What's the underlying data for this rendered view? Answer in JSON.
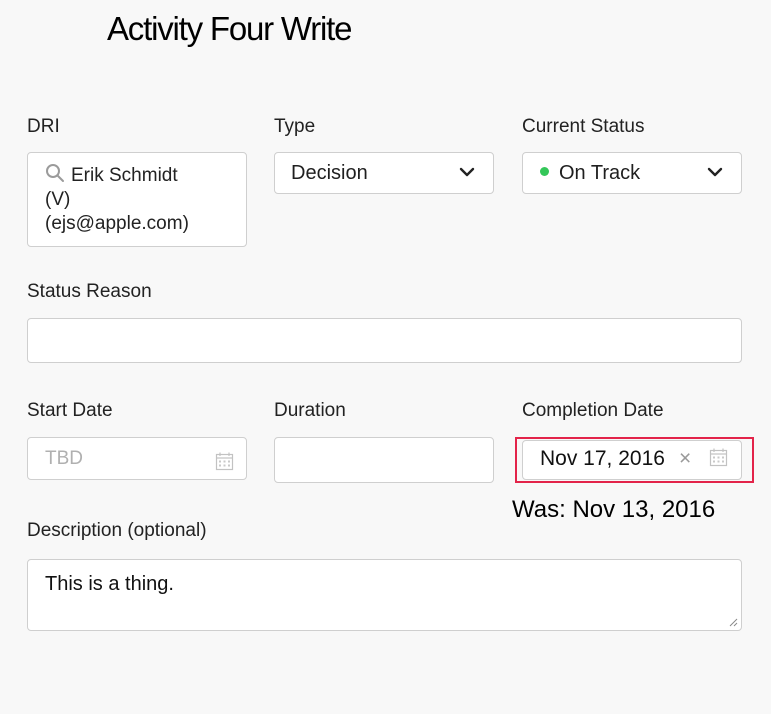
{
  "page": {
    "title": "Activity Four Write"
  },
  "fields": {
    "dri": {
      "label": "DRI",
      "value_line1": "Erik Schmidt",
      "value_line2": "(V)",
      "value_line3": "(ejs@apple.com)",
      "icon": "search-icon"
    },
    "type": {
      "label": "Type",
      "value": "Decision",
      "icon": "chevron-down-icon"
    },
    "current_status": {
      "label": "Current Status",
      "value": "On Track",
      "status_color": "#34c759",
      "icon": "chevron-down-icon"
    },
    "status_reason": {
      "label": "Status Reason",
      "value": ""
    },
    "start_date": {
      "label": "Start Date",
      "placeholder": "TBD",
      "icon": "calendar-icon"
    },
    "duration": {
      "label": "Duration",
      "value": ""
    },
    "completion_date": {
      "label": "Completion Date",
      "value": "Nov 17, 2016",
      "clear_glyph": "×",
      "icon": "calendar-icon",
      "annotation": "Was: Nov 13, 2016",
      "highlight_color": "#e3244a"
    },
    "description": {
      "label": "Description (optional)",
      "value": "This is a thing."
    }
  }
}
